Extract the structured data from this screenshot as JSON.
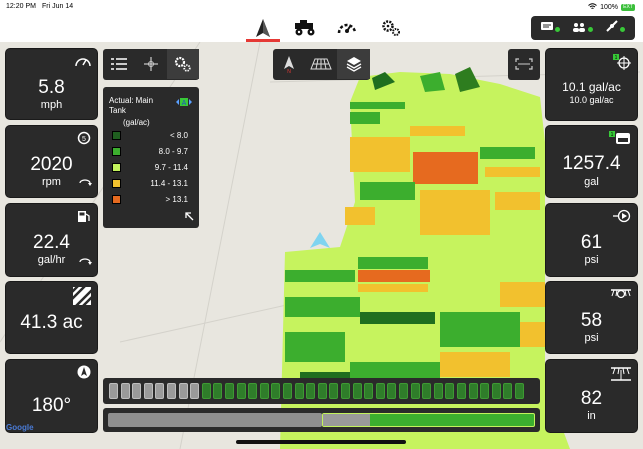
{
  "status": {
    "time": "12:20 PM",
    "date": "Fri Jun 14",
    "battery_pct": "100%",
    "battery_badge": "EXT"
  },
  "nav": {
    "icons": [
      "guidance-arrow-icon",
      "tractor-icon",
      "gauge-icon",
      "settings-gears-icon"
    ],
    "active_index": 0
  },
  "left_tiles": [
    {
      "name": "speed",
      "value": "5.8",
      "unit": "mph",
      "icon": "speedometer-icon"
    },
    {
      "name": "engine",
      "value": "2020",
      "unit": "rpm",
      "icon": "engine-rpm-icon"
    },
    {
      "name": "fuel",
      "value": "22.4",
      "unit": "gal/hr",
      "icon": "fuel-pump-icon"
    },
    {
      "name": "area",
      "value": "41.3 ac",
      "unit": "",
      "icon": "area-stripes-icon"
    },
    {
      "name": "heading",
      "value": "180°",
      "unit": "",
      "icon": "compass-icon"
    }
  ],
  "right_tiles": [
    {
      "name": "rate",
      "value": "10.1 gal/ac",
      "sub": "10.0 gal/ac",
      "icon": "target-rate-icon",
      "badge": "1"
    },
    {
      "name": "tank",
      "value": "1257.4",
      "unit": "gal",
      "icon": "tank-icon",
      "badge": "1"
    },
    {
      "name": "pressure1",
      "value": "61",
      "unit": "psi",
      "icon": "pump-pressure-icon"
    },
    {
      "name": "pressure2",
      "value": "58",
      "unit": "psi",
      "icon": "boom-pressure-icon"
    },
    {
      "name": "height",
      "value": "82",
      "unit": "in",
      "icon": "boom-height-icon"
    }
  ],
  "legend": {
    "title": "Actual: Main Tank",
    "unit": "(gal/ac)",
    "ranges": [
      {
        "label": "< 8.0",
        "color": "#1f5e1f"
      },
      {
        "label": "8.0 - 9.7",
        "color": "#3cae2e"
      },
      {
        "label": "9.7 - 11.4",
        "color": "#c3f25c"
      },
      {
        "label": "11.4 - 13.1",
        "color": "#f2c12e"
      },
      {
        "label": "> 13.1",
        "color": "#e66a1f"
      }
    ]
  },
  "sections": {
    "total": 36,
    "inactive": 8
  },
  "boom_progress": {
    "gray_fraction": 0.5,
    "active_fraction": 0.5
  },
  "attribution": "Google"
}
